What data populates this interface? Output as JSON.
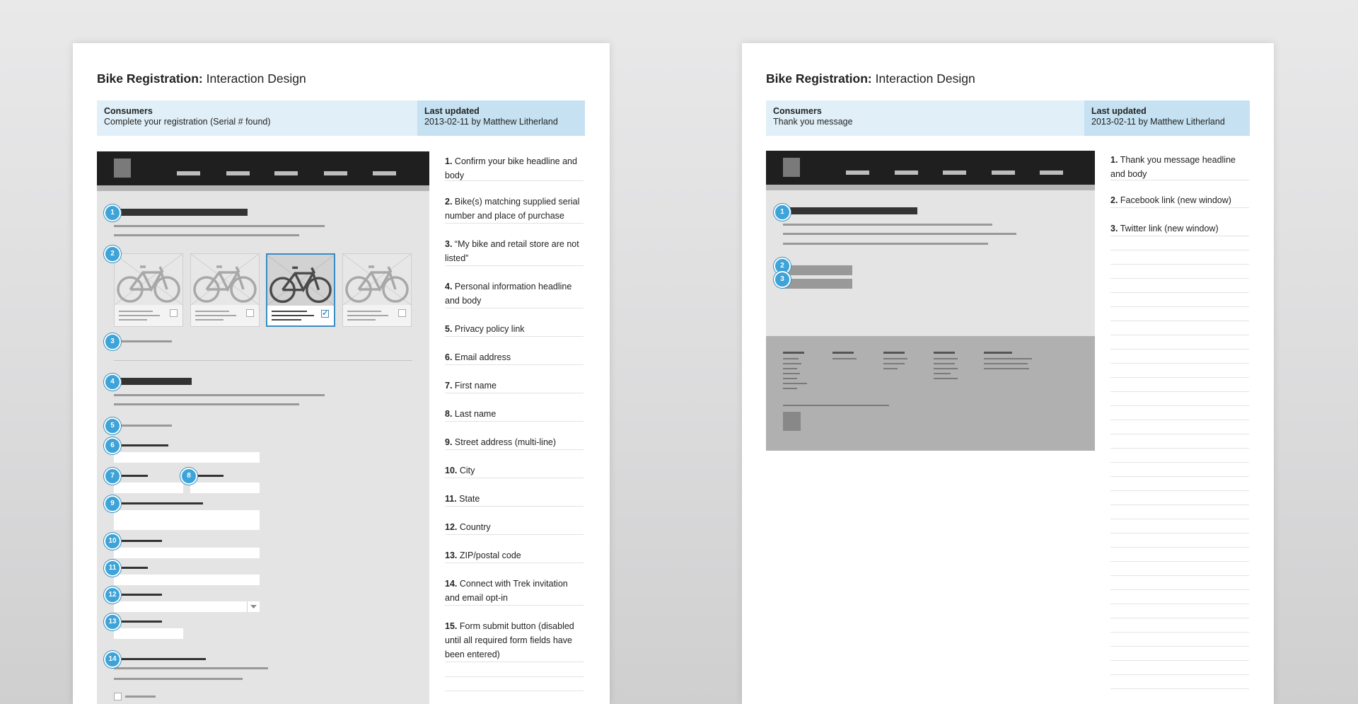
{
  "sheet1": {
    "title_bold": "Bike Registration:",
    "title_rest": "Interaction Design",
    "audience_label": "Consumers",
    "audience_value": "Complete your registration (Serial # found)",
    "updated_label": "Last updated",
    "updated_value": "2013-02-11 by Matthew Litherland",
    "markers": [
      "1",
      "2",
      "3",
      "4",
      "5",
      "6",
      "7",
      "8",
      "9",
      "10",
      "11",
      "12",
      "13",
      "14"
    ],
    "notes": [
      {
        "n": "1.",
        "text": "Confirm your bike headline and body"
      },
      {
        "n": "2.",
        "text": "Bike(s) matching supplied serial number and place of purchase"
      },
      {
        "n": "3.",
        "text": "“My bike and retail store are not listed”"
      },
      {
        "n": "4.",
        "text": "Personal information headline and body"
      },
      {
        "n": "5.",
        "text": "Privacy policy link"
      },
      {
        "n": "6.",
        "text": "Email address"
      },
      {
        "n": "7.",
        "text": "First name"
      },
      {
        "n": "8.",
        "text": "Last name"
      },
      {
        "n": "9.",
        "text": "Street address (multi-line)"
      },
      {
        "n": "10.",
        "text": "City"
      },
      {
        "n": "11.",
        "text": "State"
      },
      {
        "n": "12.",
        "text": "Country"
      },
      {
        "n": "13.",
        "text": "ZIP/postal code"
      },
      {
        "n": "14.",
        "text": "Connect with Trek invitation and email opt-in"
      },
      {
        "n": "15.",
        "text": "Form submit button (disabled until all required form fields have been entered)"
      }
    ]
  },
  "sheet2": {
    "title_bold": "Bike Registration:",
    "title_rest": "Interaction Design",
    "audience_label": "Consumers",
    "audience_value": "Thank you message",
    "updated_label": "Last updated",
    "updated_value": "2013-02-11 by Matthew Litherland",
    "markers": [
      "1",
      "2",
      "3"
    ],
    "notes": [
      {
        "n": "1.",
        "text": "Thank you message headline and body"
      },
      {
        "n": "2.",
        "text": "Facebook link (new window)"
      },
      {
        "n": "3.",
        "text": "Twitter link (new window)"
      }
    ]
  },
  "colors": {
    "marker": "#3ea3d8",
    "header_band_light": "#e1f0f8",
    "header_band_dark": "#c6e2f2",
    "wireframe_nav": "#1f1f1f",
    "wireframe_bg": "#e4e4e4",
    "selected_card": "#3a8cc4"
  },
  "icons": {
    "bike": "bicycle-icon",
    "checkbox": "checkbox-icon",
    "dropdown": "chevron-down-icon"
  }
}
